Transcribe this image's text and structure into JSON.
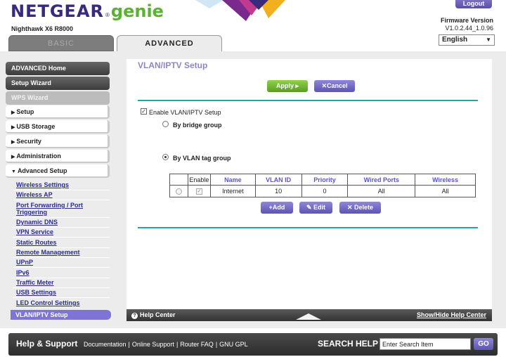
{
  "header": {
    "brand": "NETGEAR",
    "reg_mark": "®",
    "product": "genie",
    "model": "Nighthawk X6 R8000",
    "logout_label": "Logout",
    "firmware_label": "Firmware Version",
    "firmware_version": "V1.0.2.44_1.0.96",
    "language": "English"
  },
  "tabs": {
    "basic": "BASIC",
    "advanced": "ADVANCED"
  },
  "sidebar": {
    "advanced_home": "ADVANCED Home",
    "setup_wizard": "Setup Wizard",
    "wps_wizard": "WPS Wizard",
    "menu": [
      "Setup",
      "USB Storage",
      "Security",
      "Administration",
      "Advanced Setup"
    ],
    "submenu": [
      "Wireless Settings",
      "Wireless AP",
      "Port Forwarding / Port",
      "Triggering",
      "Dynamic DNS",
      "VPN Service",
      "Static Routes",
      "Remote Management",
      "UPnP",
      "IPv6",
      "Traffic Meter",
      "USB Settings",
      "LED Control Settings"
    ],
    "active": "VLAN/IPTV Setup"
  },
  "content": {
    "title": "VLAN/IPTV Setup",
    "apply_label": "Apply ▸",
    "cancel_label": "Cancel",
    "enable_label": "Enable VLAN/IPTV Setup",
    "enable_checked": true,
    "bridge_label": "By bridge group",
    "tag_label": "By VLAN tag group",
    "selected_mode": "By VLAN tag group",
    "table": {
      "headers": [
        "",
        "Enable",
        "Name",
        "VLAN ID",
        "Priority",
        "Wired Ports",
        "Wireless"
      ],
      "rows": [
        {
          "enable": true,
          "name": "Internet",
          "vlan_id": "10",
          "priority": "0",
          "wired_ports": "All",
          "wireless": "All"
        }
      ]
    },
    "add_label": "Add",
    "edit_label": "Edit",
    "delete_label": "Delete"
  },
  "helpbar": {
    "help_center": "Help Center",
    "toggle": "Show/Hide Help Center"
  },
  "footer": {
    "title": "Help & Support",
    "links": [
      "Documentation",
      "Online Support",
      "Router FAQ",
      "GNU GPL"
    ],
    "search_label": "SEARCH HELP",
    "search_placeholder": "Enter Search Item",
    "go_label": "GO"
  },
  "colors": {
    "brand_purple": "#3a2a7d",
    "genie_green": "#5bb230",
    "accent_purple": "#5e54b2",
    "apply_green": "#5a9e22",
    "rule_teal": "#2ca0a8"
  }
}
